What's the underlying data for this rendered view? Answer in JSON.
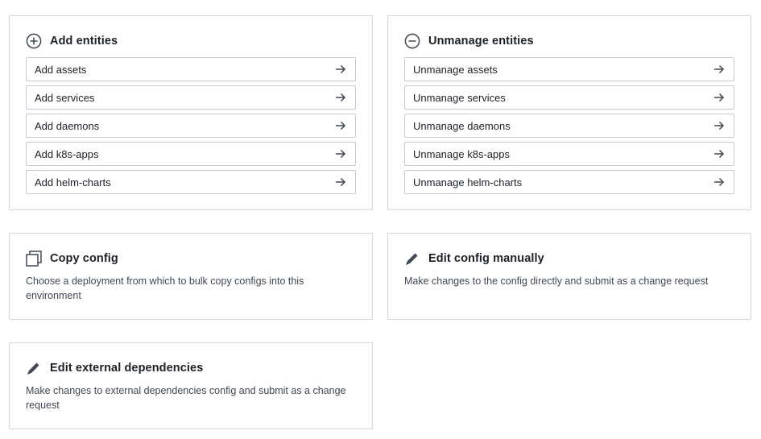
{
  "add_entities": {
    "title": "Add entities",
    "icon": "plus-circle-icon",
    "items": [
      {
        "label": "Add assets"
      },
      {
        "label": "Add services"
      },
      {
        "label": "Add daemons"
      },
      {
        "label": "Add k8s-apps"
      },
      {
        "label": "Add helm-charts"
      }
    ]
  },
  "unmanage_entities": {
    "title": "Unmanage entities",
    "icon": "minus-circle-icon",
    "items": [
      {
        "label": "Unmanage assets"
      },
      {
        "label": "Unmanage services"
      },
      {
        "label": "Unmanage daemons"
      },
      {
        "label": "Unmanage k8s-apps"
      },
      {
        "label": "Unmanage helm-charts"
      }
    ]
  },
  "copy_config": {
    "title": "Copy config",
    "icon": "duplicate-icon",
    "description": "Choose a deployment from which to bulk copy configs into this environment"
  },
  "edit_config": {
    "title": "Edit config manually",
    "icon": "pencil-icon",
    "description": "Make changes to the config directly and submit as a change request"
  },
  "edit_external": {
    "title": "Edit external dependencies",
    "icon": "pencil-icon",
    "description": "Make changes to external dependencies config and submit as a change request"
  },
  "colors": {
    "text": "#1c2127",
    "muted_text": "#404854",
    "border": "#d3d8de",
    "icon": "#5f6b7c"
  }
}
